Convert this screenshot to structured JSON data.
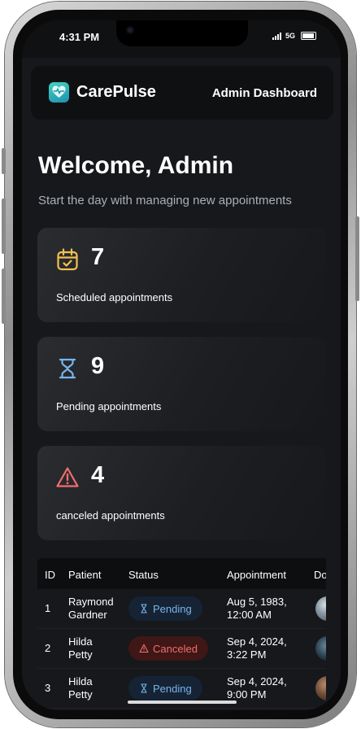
{
  "status_bar": {
    "time": "4:31 PM",
    "network": "5G"
  },
  "header": {
    "brand": "CarePulse",
    "title": "Admin Dashboard"
  },
  "welcome": {
    "title": "Welcome, Admin",
    "subtitle": "Start the day with managing new appointments"
  },
  "stats": [
    {
      "icon": "calendar-check-icon",
      "value": "7",
      "label": "Scheduled appointments",
      "color": "#f2c14e"
    },
    {
      "icon": "hourglass-icon",
      "value": "9",
      "label": "Pending appointments",
      "color": "#79b5ec"
    },
    {
      "icon": "alert-triangle-icon",
      "value": "4",
      "label": "canceled appointments",
      "color": "#f36d6d"
    }
  ],
  "table": {
    "headers": [
      "ID",
      "Patient",
      "Status",
      "Appointment",
      "Do"
    ],
    "rows": [
      {
        "id": "1",
        "patient": [
          "Raymond",
          "Gardner"
        ],
        "status": "Pending",
        "appointment": [
          "Aug 5, 1983,",
          "12:00 AM"
        ]
      },
      {
        "id": "2",
        "patient": [
          "Hilda",
          "Petty"
        ],
        "status": "Canceled",
        "appointment": [
          "Sep 4, 2024,",
          "3:22 PM"
        ]
      },
      {
        "id": "3",
        "patient": [
          "Hilda",
          "Petty"
        ],
        "status": "Pending",
        "appointment": [
          "Sep 4, 2024,",
          "9:00 PM"
        ]
      }
    ]
  },
  "colors": {
    "background": "#16181b",
    "card": "#1f2125",
    "pending_bg": "#152334",
    "pending_text": "#79b5ec",
    "cancelled_bg": "#3e1716",
    "cancelled_text": "#f36d6d",
    "accent_teal": "#41d6c0"
  }
}
